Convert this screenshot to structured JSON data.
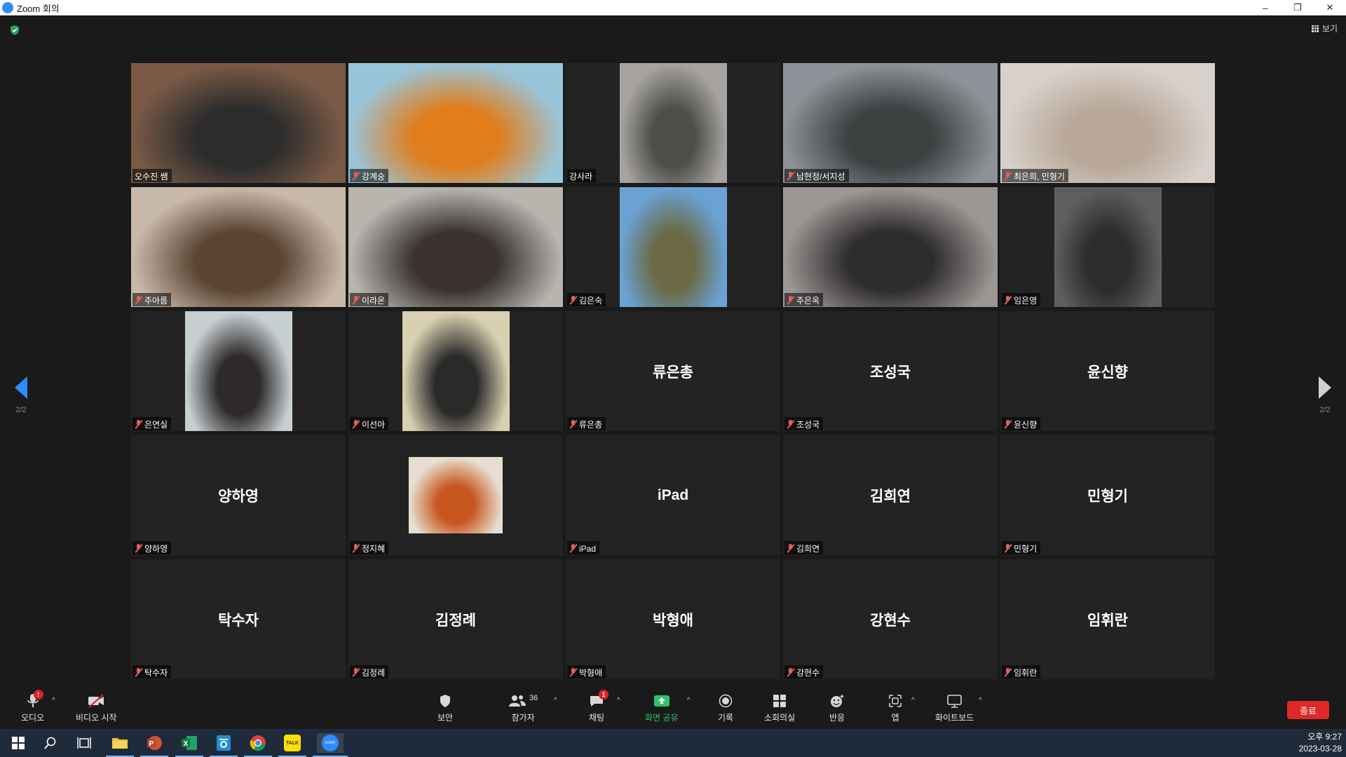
{
  "window": {
    "title": "Zoom 회의",
    "minimize": "–",
    "restore": "❐",
    "close": "✕"
  },
  "view_button": {
    "label": "보기"
  },
  "pager": {
    "left": "2/2",
    "right": "2/2"
  },
  "participants": [
    {
      "name": "오수진 쌤",
      "active": true,
      "muted": false,
      "video": {
        "type": "wide",
        "colors": [
          "#7a5a46",
          "#2c2c2c"
        ]
      }
    },
    {
      "name": "강계숭",
      "muted": true,
      "video": {
        "type": "wide",
        "colors": [
          "#9ac4d8",
          "#e07d1c"
        ]
      }
    },
    {
      "name": "강사라",
      "muted": false,
      "video": {
        "type": "portrait",
        "colors": [
          "#a6a39f",
          "#4e4e4a"
        ]
      }
    },
    {
      "name": "남현정/서지성",
      "muted": true,
      "video": {
        "type": "wide",
        "colors": [
          "#8c9297",
          "#3e4142"
        ]
      }
    },
    {
      "name": "최은희, 민형기",
      "muted": true,
      "video": {
        "type": "wide",
        "colors": [
          "#d8d1cb",
          "#b9a89a"
        ]
      }
    },
    {
      "name": "주아름",
      "muted": true,
      "video": {
        "type": "wide",
        "colors": [
          "#c9b9aa",
          "#5a4433"
        ]
      }
    },
    {
      "name": "이라온",
      "muted": true,
      "video": {
        "type": "wide",
        "colors": [
          "#b8b4ae",
          "#3a3330"
        ]
      }
    },
    {
      "name": "김은숙",
      "muted": true,
      "video": {
        "type": "portrait",
        "colors": [
          "#6aa2d4",
          "#6b6a45"
        ]
      }
    },
    {
      "name": "주은옥",
      "muted": true,
      "video": {
        "type": "wide",
        "colors": [
          "#9c9694",
          "#2e2c2c"
        ]
      }
    },
    {
      "name": "임은영",
      "muted": true,
      "video": {
        "type": "portrait",
        "colors": [
          "#5d5f5e",
          "#2b2c2c"
        ]
      }
    },
    {
      "name": "은연실",
      "muted": true,
      "video": {
        "type": "portrait",
        "colors": [
          "#c8cfd3",
          "#2e2a2a"
        ]
      }
    },
    {
      "name": "이선아",
      "muted": true,
      "video": {
        "type": "portrait",
        "colors": [
          "#d8d0b0",
          "#2a2a2a"
        ]
      }
    },
    {
      "name": "류은총",
      "muted": true,
      "center": "류은총"
    },
    {
      "name": "조성국",
      "muted": true,
      "center": "조성국"
    },
    {
      "name": "윤신향",
      "muted": true,
      "center": "윤신향"
    },
    {
      "name": "양하영",
      "muted": true,
      "center": "양하영"
    },
    {
      "name": "정지혜",
      "muted": true,
      "video": {
        "type": "thumb",
        "colors": [
          "#e7ddd0",
          "#c8571f"
        ]
      }
    },
    {
      "name": "iPad",
      "muted": true,
      "center": "iPad"
    },
    {
      "name": "김희연",
      "muted": true,
      "center": "김희연"
    },
    {
      "name": "민형기",
      "muted": true,
      "center": "민형기"
    },
    {
      "name": "탁수자",
      "muted": true,
      "center": "탁수자"
    },
    {
      "name": "김정례",
      "muted": true,
      "center": "김정례"
    },
    {
      "name": "박형애",
      "muted": true,
      "center": "박형애"
    },
    {
      "name": "강현수",
      "muted": true,
      "center": "강현수"
    },
    {
      "name": "임휘란",
      "muted": true,
      "center": "임휘란"
    }
  ],
  "toolbar": {
    "audio": "오디오",
    "audio_badge": "!",
    "video": "비디오 시작",
    "security": "보안",
    "participants": "참가자",
    "participant_count": "36",
    "chat": "채팅",
    "chat_badge": "1",
    "share": "화면 공유",
    "record": "기록",
    "breakout": "소회의실",
    "reactions": "반응",
    "apps": "앱",
    "whiteboard": "화이트보드",
    "end": "종료"
  },
  "taskbar": {
    "time": "오후 9:27",
    "date": "2023-03-28",
    "kakao": "TALK",
    "zoom": "zoom"
  },
  "colors": {
    "accent": "#2d8cff",
    "share_green": "#2ec46a",
    "end_red": "#e02828",
    "active_border": "#d8e84a",
    "muted_red": "#e0605a"
  }
}
